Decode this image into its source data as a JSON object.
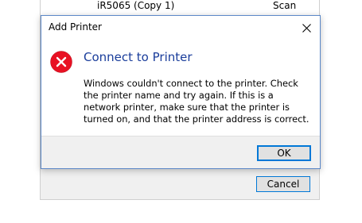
{
  "background": {
    "printer_name": "iR5065 (Copy 1)",
    "scan_label": "Scan",
    "cancel_label": "Cancel"
  },
  "dialog": {
    "title": "Add Printer",
    "heading": "Connect to Printer",
    "message": "Windows couldn't connect to the printer. Check the printer name and try again. If this is a network printer, make sure that the printer is turned on, and that the printer address is correct.",
    "ok_label": "OK",
    "icon": "error-icon",
    "colors": {
      "heading": "#1a3d9b",
      "error_icon": "#e81123",
      "ok_border": "#0078d7"
    }
  }
}
